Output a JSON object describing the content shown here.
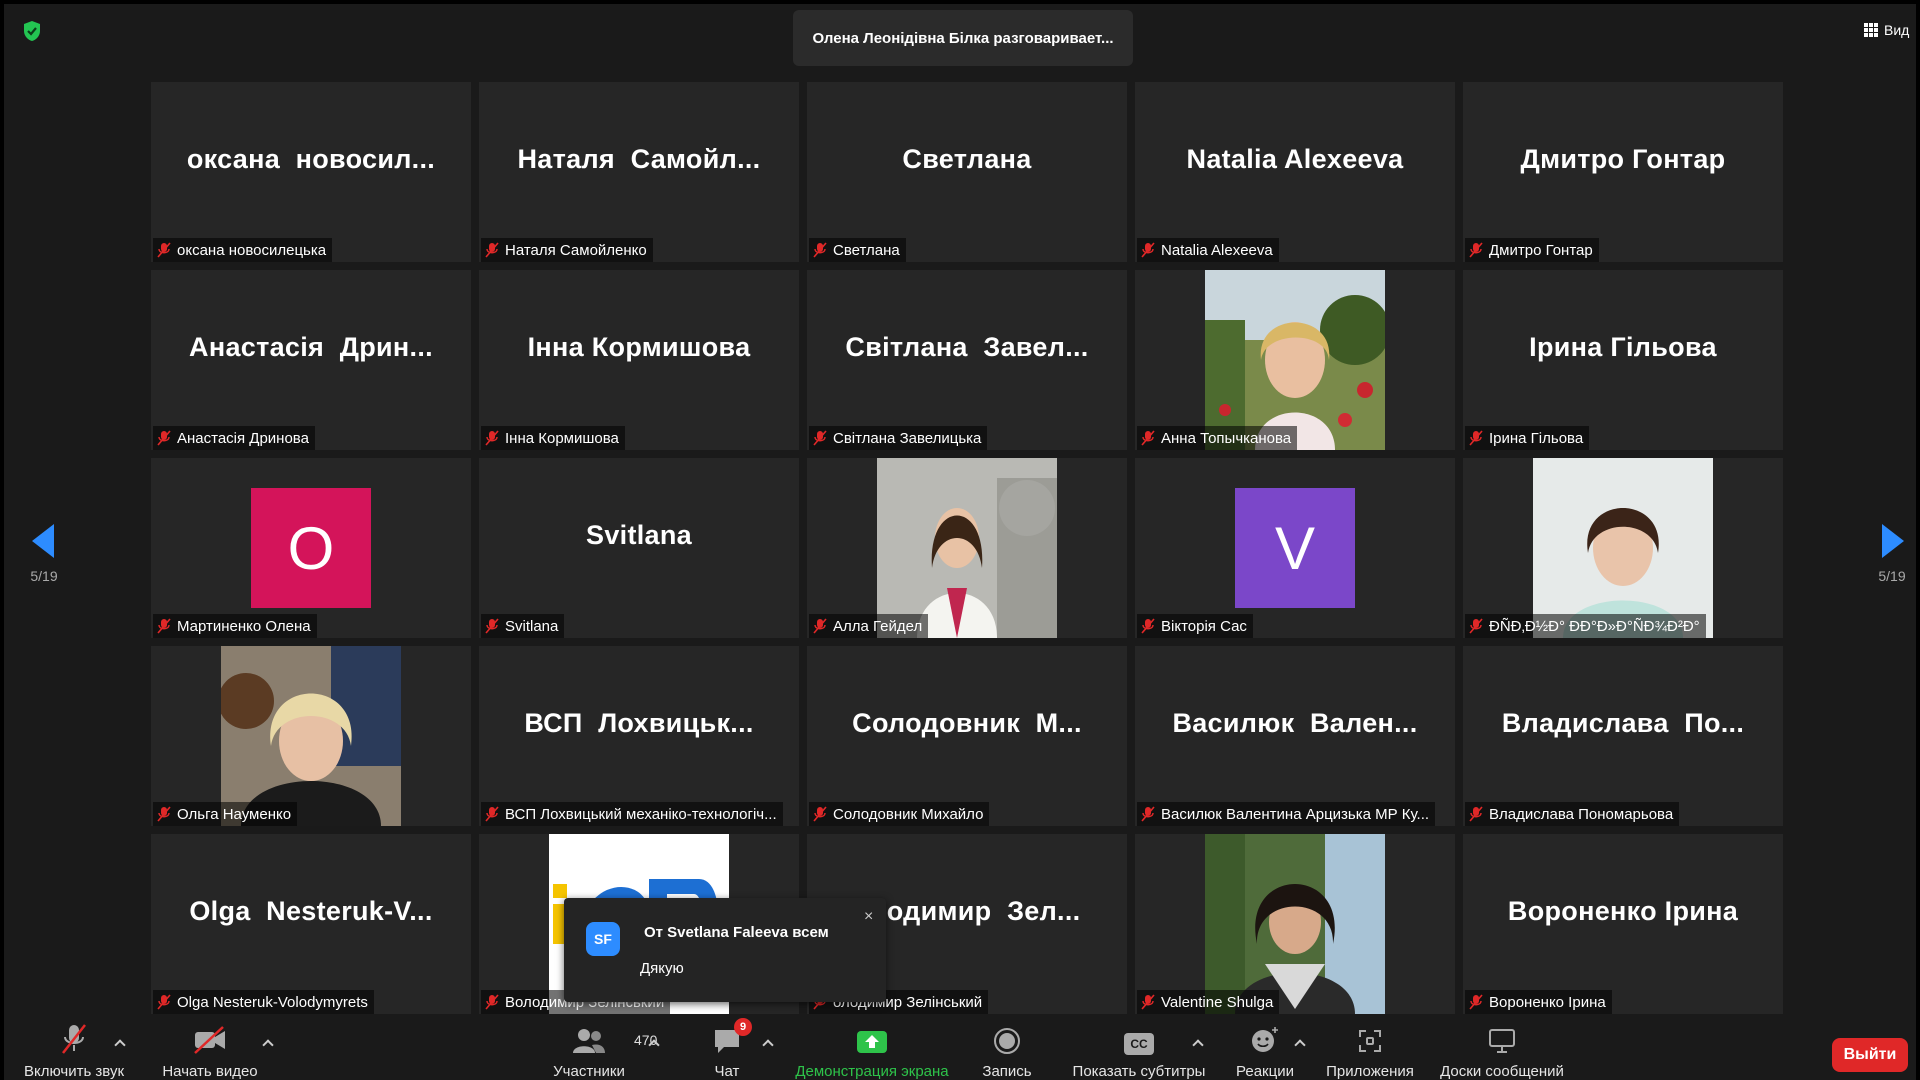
{
  "top": {
    "speaker_banner": "Олена Леонідівна Білка разговаривает...",
    "view_label": "Вид"
  },
  "pagination": {
    "left_label": "5/19",
    "right_label": "5/19"
  },
  "tiles": [
    {
      "big": "оксана  новосил...",
      "label": "оксана новосилецька"
    },
    {
      "big": "Наталя  Самойл...",
      "label": "Наталя Самойленко"
    },
    {
      "big": "Светлана",
      "label": "Светлана"
    },
    {
      "big": "Natalia Alexeeva",
      "label": "Natalia Alexeeva"
    },
    {
      "big": "Дмитро Гонтар",
      "label": "Дмитро Гонтар"
    },
    {
      "big": "Анастасія  Дрин...",
      "label": "Анастасія Дринова"
    },
    {
      "big": "Інна Кормишова",
      "label": "Інна Кормишова"
    },
    {
      "big": "Світлана  Завел...",
      "label": "Світлана Завелицька"
    },
    {
      "big": "",
      "label": "Анна Топычканова",
      "photo": "woman-roses"
    },
    {
      "big": "Ірина Гільова",
      "label": "Ірина Гільова"
    },
    {
      "big": "",
      "label": "Мартиненко Олена",
      "avatar": "O",
      "avatar_color": "#d4145a"
    },
    {
      "big": "Svitlana",
      "label": "Svitlana"
    },
    {
      "big": "",
      "label": "Алла Гейдел",
      "photo": "woman-white"
    },
    {
      "big": "",
      "label": "Вікторія Сас",
      "avatar": "V",
      "avatar_color": "#7b47c9"
    },
    {
      "big": "",
      "label": "ĐÑĐ‚Đ½Đ° ĐĐ°Đ»Đ°ÑĐ¾Đ²Đ°",
      "photo": "woman-shorthair"
    },
    {
      "big": "",
      "label": "Ольга Науменко",
      "photo": "woman-blonde"
    },
    {
      "big": "ВСП  Лохвицьк...",
      "label": "ВСП Лохвицький механіко-технологіч..."
    },
    {
      "big": "Солодовник  М...",
      "label": "Солодовник Михайло"
    },
    {
      "big": "Василюк  Вален...",
      "label": "Василюк Валентина Арцизька МР  Ку..."
    },
    {
      "big": "Владислава  По...",
      "label": "Владислава Пономарьова"
    },
    {
      "big": "Olga  Nesteruk-V...",
      "label": "Olga Nesteruk-Volodymyrets"
    },
    {
      "big": "",
      "label": "Володимир Зелінський",
      "photo": "logo-tile"
    },
    {
      "big": "олодимир  Зел...",
      "label": "олодимир Зелінський"
    },
    {
      "big": "",
      "label": "Valentine Shulga",
      "photo": "woman-curly"
    },
    {
      "big": "Вороненко Ірина",
      "label": "Вороненко Ірина"
    }
  ],
  "toast": {
    "avatar": "SF",
    "from": "От Svetlana Faleeva всем",
    "message": "Дякую",
    "close": "×"
  },
  "toolbar": {
    "mute_label": "Включить звук",
    "video_label": "Начать видео",
    "participants_label": "Участники",
    "participants_count": "470",
    "chat_label": "Чат",
    "chat_badge": "9",
    "share_label": "Демонстрация экрана",
    "record_label": "Запись",
    "captions_label": "Показать субтитры",
    "captions_icon_text": "CC",
    "reactions_label": "Реакции",
    "apps_label": "Приложения",
    "whiteboards_label": "Доски сообщений",
    "leave_label": "Выйти"
  },
  "colors": {
    "accent_blue": "#2d8cff",
    "leave_red": "#e02828",
    "share_green": "#2ec34a",
    "mic_muted_red": "#e02828"
  }
}
